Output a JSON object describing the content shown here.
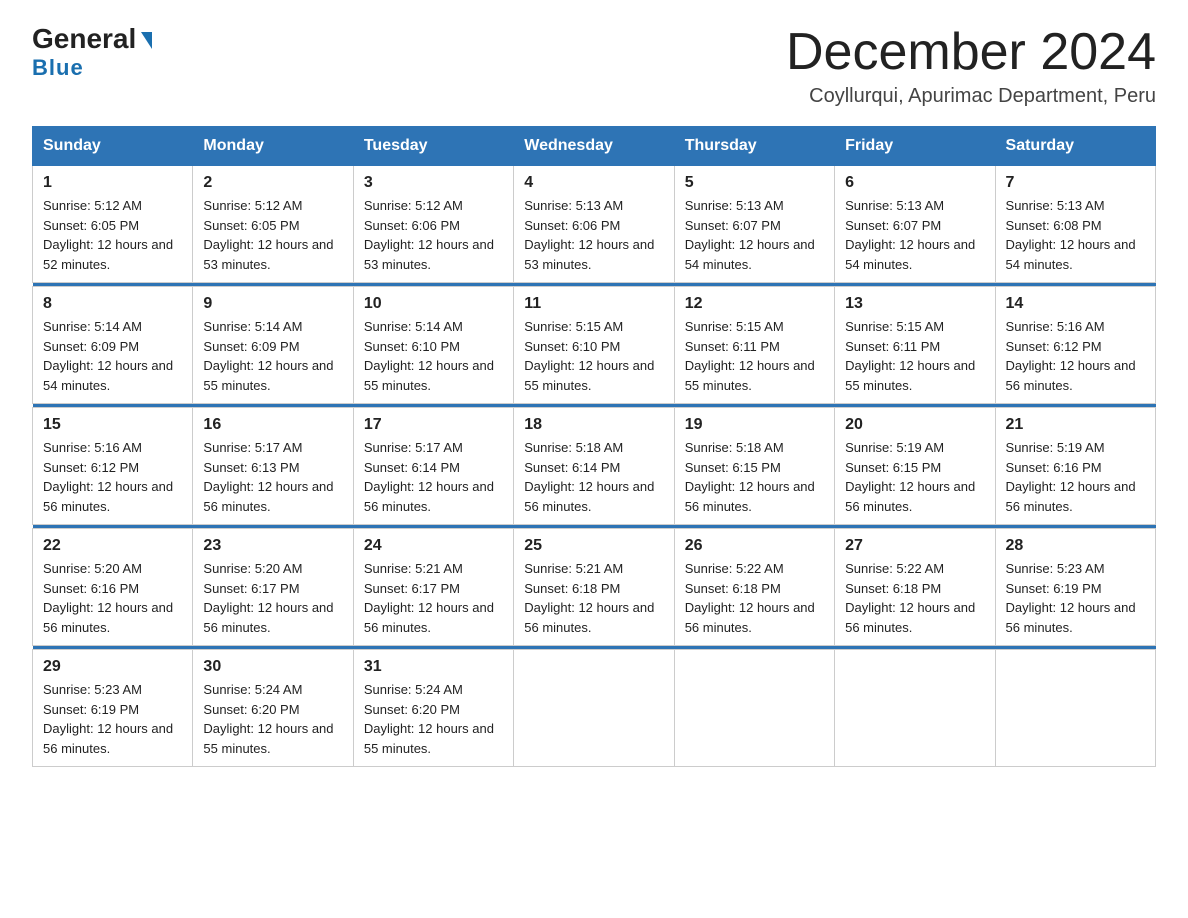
{
  "header": {
    "logo_line1": "General",
    "logo_line2": "Blue",
    "title": "December 2024",
    "subtitle": "Coyllurqui, Apurimac Department, Peru"
  },
  "days_of_week": [
    "Sunday",
    "Monday",
    "Tuesday",
    "Wednesday",
    "Thursday",
    "Friday",
    "Saturday"
  ],
  "weeks": [
    [
      {
        "day": "1",
        "sunrise": "5:12 AM",
        "sunset": "6:05 PM",
        "daylight": "12 hours and 52 minutes."
      },
      {
        "day": "2",
        "sunrise": "5:12 AM",
        "sunset": "6:05 PM",
        "daylight": "12 hours and 53 minutes."
      },
      {
        "day": "3",
        "sunrise": "5:12 AM",
        "sunset": "6:06 PM",
        "daylight": "12 hours and 53 minutes."
      },
      {
        "day": "4",
        "sunrise": "5:13 AM",
        "sunset": "6:06 PM",
        "daylight": "12 hours and 53 minutes."
      },
      {
        "day": "5",
        "sunrise": "5:13 AM",
        "sunset": "6:07 PM",
        "daylight": "12 hours and 54 minutes."
      },
      {
        "day": "6",
        "sunrise": "5:13 AM",
        "sunset": "6:07 PM",
        "daylight": "12 hours and 54 minutes."
      },
      {
        "day": "7",
        "sunrise": "5:13 AM",
        "sunset": "6:08 PM",
        "daylight": "12 hours and 54 minutes."
      }
    ],
    [
      {
        "day": "8",
        "sunrise": "5:14 AM",
        "sunset": "6:09 PM",
        "daylight": "12 hours and 54 minutes."
      },
      {
        "day": "9",
        "sunrise": "5:14 AM",
        "sunset": "6:09 PM",
        "daylight": "12 hours and 55 minutes."
      },
      {
        "day": "10",
        "sunrise": "5:14 AM",
        "sunset": "6:10 PM",
        "daylight": "12 hours and 55 minutes."
      },
      {
        "day": "11",
        "sunrise": "5:15 AM",
        "sunset": "6:10 PM",
        "daylight": "12 hours and 55 minutes."
      },
      {
        "day": "12",
        "sunrise": "5:15 AM",
        "sunset": "6:11 PM",
        "daylight": "12 hours and 55 minutes."
      },
      {
        "day": "13",
        "sunrise": "5:15 AM",
        "sunset": "6:11 PM",
        "daylight": "12 hours and 55 minutes."
      },
      {
        "day": "14",
        "sunrise": "5:16 AM",
        "sunset": "6:12 PM",
        "daylight": "12 hours and 56 minutes."
      }
    ],
    [
      {
        "day": "15",
        "sunrise": "5:16 AM",
        "sunset": "6:12 PM",
        "daylight": "12 hours and 56 minutes."
      },
      {
        "day": "16",
        "sunrise": "5:17 AM",
        "sunset": "6:13 PM",
        "daylight": "12 hours and 56 minutes."
      },
      {
        "day": "17",
        "sunrise": "5:17 AM",
        "sunset": "6:14 PM",
        "daylight": "12 hours and 56 minutes."
      },
      {
        "day": "18",
        "sunrise": "5:18 AM",
        "sunset": "6:14 PM",
        "daylight": "12 hours and 56 minutes."
      },
      {
        "day": "19",
        "sunrise": "5:18 AM",
        "sunset": "6:15 PM",
        "daylight": "12 hours and 56 minutes."
      },
      {
        "day": "20",
        "sunrise": "5:19 AM",
        "sunset": "6:15 PM",
        "daylight": "12 hours and 56 minutes."
      },
      {
        "day": "21",
        "sunrise": "5:19 AM",
        "sunset": "6:16 PM",
        "daylight": "12 hours and 56 minutes."
      }
    ],
    [
      {
        "day": "22",
        "sunrise": "5:20 AM",
        "sunset": "6:16 PM",
        "daylight": "12 hours and 56 minutes."
      },
      {
        "day": "23",
        "sunrise": "5:20 AM",
        "sunset": "6:17 PM",
        "daylight": "12 hours and 56 minutes."
      },
      {
        "day": "24",
        "sunrise": "5:21 AM",
        "sunset": "6:17 PM",
        "daylight": "12 hours and 56 minutes."
      },
      {
        "day": "25",
        "sunrise": "5:21 AM",
        "sunset": "6:18 PM",
        "daylight": "12 hours and 56 minutes."
      },
      {
        "day": "26",
        "sunrise": "5:22 AM",
        "sunset": "6:18 PM",
        "daylight": "12 hours and 56 minutes."
      },
      {
        "day": "27",
        "sunrise": "5:22 AM",
        "sunset": "6:18 PM",
        "daylight": "12 hours and 56 minutes."
      },
      {
        "day": "28",
        "sunrise": "5:23 AM",
        "sunset": "6:19 PM",
        "daylight": "12 hours and 56 minutes."
      }
    ],
    [
      {
        "day": "29",
        "sunrise": "5:23 AM",
        "sunset": "6:19 PM",
        "daylight": "12 hours and 56 minutes."
      },
      {
        "day": "30",
        "sunrise": "5:24 AM",
        "sunset": "6:20 PM",
        "daylight": "12 hours and 55 minutes."
      },
      {
        "day": "31",
        "sunrise": "5:24 AM",
        "sunset": "6:20 PM",
        "daylight": "12 hours and 55 minutes."
      },
      null,
      null,
      null,
      null
    ]
  ]
}
